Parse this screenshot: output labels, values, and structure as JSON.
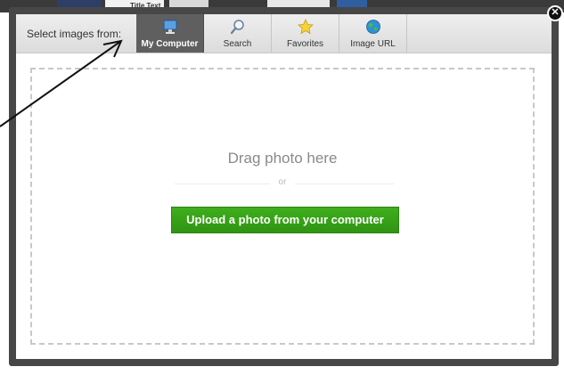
{
  "background_page": {
    "title_fragment": "Title Text"
  },
  "dialog": {
    "tabbar_label": "Select images from:",
    "tabs": [
      {
        "label": "My Computer",
        "icon": "monitor-icon",
        "active": true
      },
      {
        "label": "Search",
        "icon": "magnifier-icon",
        "active": false
      },
      {
        "label": "Favorites",
        "icon": "star-icon",
        "active": false
      },
      {
        "label": "Image URL",
        "icon": "globe-icon",
        "active": false
      }
    ],
    "dropzone": {
      "drag_text": "Drag photo here",
      "or_text": "or",
      "upload_button": "Upload a photo from your computer"
    },
    "close_icon": "close-icon"
  },
  "colors": {
    "active_tab": "#5f5f5f",
    "upload_button": "#35a017",
    "modal_frame": "#474747"
  }
}
